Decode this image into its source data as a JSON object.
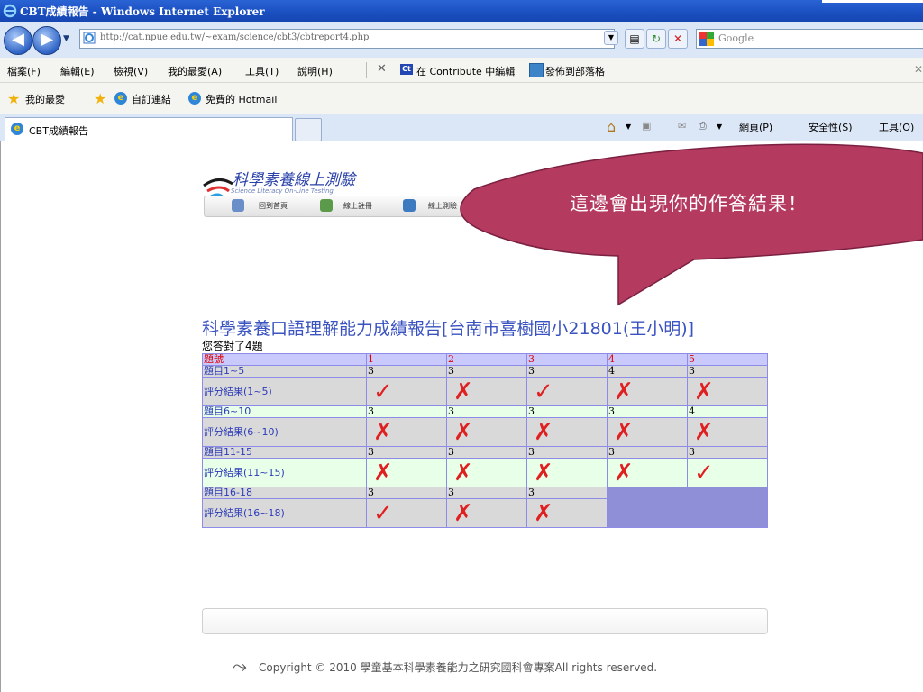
{
  "window": {
    "title": "CBT成績報告 - Windows Internet Explorer"
  },
  "address_bar": {
    "url": "http://cat.npue.edu.tw/~exam/science/cbt3/cbtreport4.php",
    "search_placeholder": "Google"
  },
  "menu": {
    "items": [
      "檔案(F)",
      "編輯(E)",
      "檢視(V)",
      "我的最愛(A)",
      "工具(T)",
      "說明(H)"
    ],
    "contribute_edit": "在 Contribute 中編輯",
    "publish_blog": "發佈到部落格"
  },
  "favorites": {
    "label": "我的最愛",
    "links": [
      "自訂連結",
      "免費的 Hotmail"
    ]
  },
  "tab": {
    "active_label": "CBT成績報告",
    "commands": [
      "網頁(P)",
      "安全性(S)",
      "工具(O)"
    ]
  },
  "page": {
    "logo_title": "科學素養線上測驗",
    "logo_subtitle": "Science Literacy On-Line Testing",
    "nav": [
      "回到首頁",
      "線上註冊",
      "線上測驗"
    ],
    "report_title": "科學素養口語理解能力成績報告[台南市喜樹國小21801(王小明)]",
    "answered_text": "您答對了4題",
    "table": {
      "header": {
        "label": "題號",
        "cells": [
          "1",
          "2",
          "3",
          "4",
          "5"
        ]
      },
      "groups": [
        {
          "q_label": "題目1~5",
          "answers": [
            "3",
            "3",
            "3",
            "4",
            "3"
          ],
          "r_label": "評分結果(1~5)",
          "results": [
            "correct",
            "wrong",
            "correct",
            "wrong",
            "wrong"
          ]
        },
        {
          "q_label": "題目6~10",
          "answers": [
            "3",
            "3",
            "3",
            "3",
            "4"
          ],
          "r_label": "評分結果(6~10)",
          "results": [
            "wrong",
            "wrong",
            "wrong",
            "wrong",
            "wrong"
          ]
        },
        {
          "q_label": "題目11-15",
          "answers": [
            "3",
            "3",
            "3",
            "3",
            "3"
          ],
          "r_label": "評分結果(11~15)",
          "results": [
            "wrong",
            "wrong",
            "wrong",
            "wrong",
            "correct"
          ]
        },
        {
          "q_label": "題目16-18",
          "answers": [
            "3",
            "3",
            "3"
          ],
          "r_label": "評分結果(16~18)",
          "results": [
            "correct",
            "wrong",
            "wrong"
          ]
        }
      ]
    },
    "copyright": "Copyright © 2010 學童基本科學素養能力之研究國科會專案All rights reserved."
  },
  "callout": {
    "text": "這邊會出現你的作答結果！",
    "color": "#b53a60"
  },
  "icons": {
    "correct": "✓",
    "wrong": "✗"
  }
}
